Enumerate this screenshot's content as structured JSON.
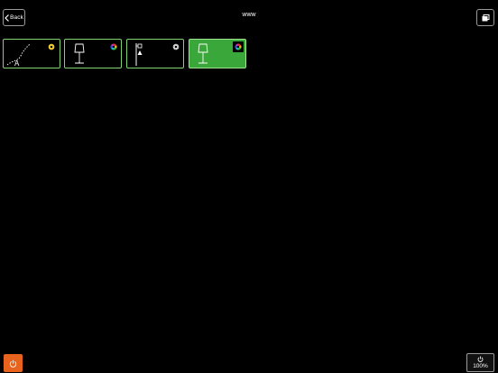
{
  "header": {
    "back_label": "Back",
    "title": "www"
  },
  "tiles": [
    {
      "name": "tile-led-strip",
      "letter": "A",
      "indicator": "color-wheel-icon",
      "active": false
    },
    {
      "name": "tile-table-lamp",
      "indicator": "color-wheel-icon",
      "active": false
    },
    {
      "name": "tile-floor-lamp",
      "indicator": "color-wheel-icon",
      "active": false
    },
    {
      "name": "tile-table-lamp-2",
      "indicator": "color-wheel-icon",
      "active": true
    }
  ],
  "footer": {
    "master_level": "100%"
  },
  "colors": {
    "background": "#000000",
    "tile_border": "#7fd46f",
    "tile_active": "#3aa73b",
    "power": "#e8641e"
  }
}
